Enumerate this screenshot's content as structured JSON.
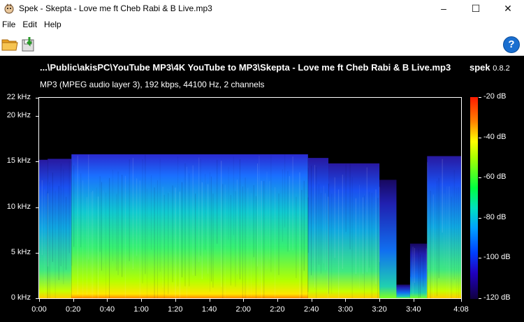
{
  "window": {
    "title": "Spek - Skepta - Love me ft Cheb Rabi & B Live.mp3",
    "buttons": [
      "minimize",
      "maximize",
      "close"
    ]
  },
  "menu": [
    "File",
    "Edit",
    "Help"
  ],
  "toolbar": {
    "open_icon": "open-folder-icon",
    "save_icon": "save-icon",
    "help_icon": "help-icon",
    "help_glyph": "?"
  },
  "header": {
    "file_path": "...\\Public\\akisPC\\YouTube MP3\\4K YouTube to MP3\\Skepta - Love me ft Cheb Rabi & B Live.mp3",
    "app_name": "spek",
    "version": "0.8.2",
    "stream_info": "MP3 (MPEG audio layer 3), 192 kbps, 44100 Hz, 2 channels"
  },
  "chart_data": {
    "type": "heatmap",
    "title": "",
    "y_axis": {
      "unit": "kHz",
      "ticks": [
        "0 kHz",
        "5 kHz",
        "10 kHz",
        "15 kHz",
        "20 kHz",
        "22 kHz"
      ],
      "tick_values": [
        0,
        5,
        10,
        15,
        20,
        22
      ],
      "range": [
        0,
        22
      ]
    },
    "x_axis": {
      "ticks": [
        "0:00",
        "0:20",
        "0:40",
        "1:00",
        "1:20",
        "1:40",
        "2:00",
        "2:20",
        "2:40",
        "3:00",
        "3:20",
        "3:40",
        "4:08"
      ],
      "tick_seconds": [
        0,
        20,
        40,
        60,
        80,
        100,
        120,
        140,
        160,
        180,
        200,
        220,
        248
      ],
      "range_seconds": [
        0,
        248
      ]
    },
    "colorbar": {
      "ticks": [
        "-20 dB",
        "-40 dB",
        "-60 dB",
        "-80 dB",
        "-100 dB",
        "-120 dB"
      ],
      "tick_values": [
        -20,
        -40,
        -60,
        -80,
        -100,
        -120
      ],
      "range": [
        -120,
        -20
      ]
    },
    "segments": [
      {
        "start": 0,
        "end": 5,
        "cutoff_khz": 15.2,
        "level": 0.45
      },
      {
        "start": 5,
        "end": 19,
        "cutoff_khz": 15.3,
        "level": 0.55
      },
      {
        "start": 19,
        "end": 158,
        "cutoff_khz": 15.8,
        "level": 0.85
      },
      {
        "start": 158,
        "end": 170,
        "cutoff_khz": 15.4,
        "level": 0.6
      },
      {
        "start": 170,
        "end": 200,
        "cutoff_khz": 14.8,
        "level": 0.5
      },
      {
        "start": 200,
        "end": 210,
        "cutoff_khz": 13.0,
        "level": 0.25
      },
      {
        "start": 210,
        "end": 218,
        "cutoff_khz": 1.5,
        "level": 0.1
      },
      {
        "start": 218,
        "end": 228,
        "cutoff_khz": 6.0,
        "level": 0.35
      },
      {
        "start": 228,
        "end": 248,
        "cutoff_khz": 15.6,
        "level": 0.55
      }
    ]
  }
}
